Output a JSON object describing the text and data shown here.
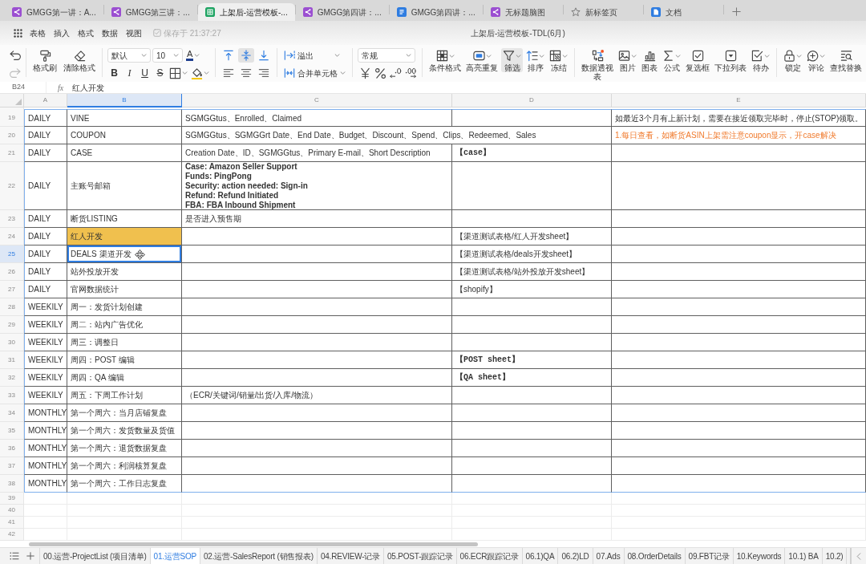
{
  "browser_tabs": [
    {
      "kind": "mindmap",
      "label": "GMGG第一讲：A...",
      "selected": false
    },
    {
      "kind": "mindmap",
      "label": "GMGG第三讲：...",
      "selected": false
    },
    {
      "kind": "sheet",
      "label": "上架后-运营模板-...",
      "selected": true
    },
    {
      "kind": "mindmap",
      "label": "GMGG第四讲：...",
      "selected": false
    },
    {
      "kind": "doc",
      "label": "GMGG第四讲：...",
      "selected": false
    },
    {
      "kind": "mindmap",
      "label": "无标题脑图",
      "selected": false
    },
    {
      "kind": "newtab",
      "label": "新标签页",
      "selected": false
    },
    {
      "kind": "home",
      "label": "文档",
      "selected": false
    }
  ],
  "menu": {
    "items": [
      "表格",
      "插入",
      "格式",
      "数据",
      "视图"
    ],
    "save_status": "保存于 21:37:27",
    "title": "上架后-运营模板-TDL(6月)"
  },
  "toolbar": {
    "undo": {
      "disabled": false
    },
    "redo": {
      "disabled": true
    },
    "format_painter": "格式刷",
    "clear_format": "清除格式",
    "font_dropdown": "默认",
    "size_dropdown": "10",
    "font_color": "A",
    "text_styles": [
      {
        "kind": "bold",
        "glyph": "B"
      },
      {
        "kind": "italic",
        "glyph": "I"
      },
      {
        "kind": "underline",
        "glyph": "U"
      },
      {
        "kind": "strike",
        "glyph": "S"
      }
    ],
    "vertical_align": [
      {
        "kind": "top",
        "selected": false
      },
      {
        "kind": "middle",
        "selected": true
      },
      {
        "kind": "bottom",
        "selected": false
      }
    ],
    "horizontal_align": [
      {
        "kind": "left",
        "selected": false
      },
      {
        "kind": "center",
        "selected": false
      },
      {
        "kind": "right",
        "selected": false
      }
    ],
    "wrap_dropdown": "溢出",
    "merge": "合并单元格",
    "number_dropdown": "常规",
    "tool_groups": [
      [
        {
          "kind": "conditional",
          "label": "条件格式",
          "dropdown": true,
          "active": false
        },
        {
          "kind": "highlight",
          "label": "高亮重复",
          "dropdown": true,
          "active": false
        },
        {
          "kind": "filter",
          "label": "筛选",
          "dropdown": true,
          "active": true
        },
        {
          "kind": "sort",
          "label": "排序",
          "dropdown": true,
          "active": false
        },
        {
          "kind": "freeze",
          "label": "冻结",
          "dropdown": true,
          "active": false
        }
      ],
      [
        {
          "kind": "pivot",
          "label": "数据透视表",
          "dropdown": false,
          "active": false
        },
        {
          "kind": "image",
          "label": "图片",
          "dropdown": true,
          "active": false
        },
        {
          "kind": "chart",
          "label": "图表",
          "dropdown": false,
          "active": false
        },
        {
          "kind": "formula",
          "label": "公式",
          "dropdown": true,
          "active": false
        },
        {
          "kind": "checkbox",
          "label": "复选框",
          "dropdown": false,
          "active": false
        },
        {
          "kind": "select",
          "label": "下拉列表",
          "dropdown": false,
          "active": false
        },
        {
          "kind": "todo",
          "label": "待办",
          "dropdown": true,
          "active": false
        }
      ],
      [
        {
          "kind": "lock",
          "label": "锁定",
          "dropdown": true,
          "active": false
        },
        {
          "kind": "comment",
          "label": "评论",
          "dropdown": true,
          "active": false
        },
        {
          "kind": "find",
          "label": "查找替换",
          "dropdown": false,
          "active": false
        }
      ]
    ]
  },
  "sheet": {
    "formula_bar": {
      "cell": "B24",
      "fx": "fx",
      "value": "红人开发"
    },
    "columns": [
      {
        "label": "A",
        "selected": false
      },
      {
        "label": "B",
        "selected": true
      },
      {
        "label": "C",
        "selected": false
      },
      {
        "label": "D",
        "selected": false
      },
      {
        "label": "E",
        "selected": false
      }
    ],
    "rows": [
      {
        "number": "19",
        "selected": false,
        "cells": [
          {
            "text": "DAILY",
            "selected": false
          },
          {
            "text": "VINE",
            "selected": false
          },
          {
            "text": "SGMGGtus、Enrolled、Claimed",
            "selected": false
          },
          {
            "selected": false
          },
          {
            "text": "如最近3个月有上新计划，需要在接近领取完毕时，停止(STOP)领取。",
            "selected": false
          }
        ]
      },
      {
        "number": "20",
        "selected": false,
        "cells": [
          {
            "text": "DAILY",
            "selected": false
          },
          {
            "text": "COUPON",
            "selected": false
          },
          {
            "text": "SGMGGtus、SGMGGrt Date、End Date、Budget、Discount、Spend、Clips、Redeemed、Sales",
            "selected": false
          },
          {
            "selected": false
          },
          {
            "text": "1.每日查看，如断货ASIN上架需注意coupon显示，开case解决",
            "color": "#f07b2e",
            "selected": false
          }
        ]
      },
      {
        "number": "21",
        "selected": false,
        "cells": [
          {
            "text": "DAILY",
            "selected": false
          },
          {
            "text": "CASE",
            "selected": false
          },
          {
            "text": "Creation Date、ID、SGMGGtus、Primary E-mail、Short Description",
            "selected": false
          },
          {
            "kind": "tag",
            "text": "【case】",
            "selected": false
          },
          {
            "selected": false
          }
        ]
      },
      {
        "number": "22",
        "selected": false,
        "cells": [
          {
            "text": "DAILY",
            "selected": false
          },
          {
            "text": "主账号邮箱",
            "selected": false
          },
          {
            "kind": "lines",
            "lines": [
              "Case: Amazon Seller Support",
              "Funds: PingPong",
              "Security: action needed: Sign-in",
              "Refund: Refund Initiated",
              "FBA: FBA Inbound Shipment"
            ],
            "selected": false
          },
          {
            "selected": false
          },
          {
            "selected": false
          }
        ]
      },
      {
        "number": "23",
        "selected": false,
        "cells": [
          {
            "text": "DAILY",
            "selected": false
          },
          {
            "text": "断货LISTING",
            "selected": false
          },
          {
            "text": "是否进入预售期",
            "selected": false
          },
          {
            "selected": false
          },
          {
            "selected": false
          }
        ]
      },
      {
        "number": "24",
        "selected": false,
        "cells": [
          {
            "text": "DAILY",
            "selected": false
          },
          {
            "kind": "highlight",
            "text": "红人开发",
            "color": "#f0c04e",
            "selected": false
          },
          {
            "selected": false
          },
          {
            "text": "【渠道测试表格/红人开发sheet】",
            "selected": false
          },
          {
            "selected": false
          }
        ]
      },
      {
        "number": "25",
        "selected": true,
        "cells": [
          {
            "text": "DAILY",
            "selected": false
          },
          {
            "text": "DEALS 渠道开发",
            "selected": true
          },
          {
            "selected": false
          },
          {
            "text": "【渠道测试表格/deals开发sheet】",
            "selected": false
          },
          {
            "selected": false
          }
        ]
      },
      {
        "number": "26",
        "selected": false,
        "cells": [
          {
            "text": "DAILY",
            "selected": false
          },
          {
            "text": "站外投放开发",
            "selected": false
          },
          {
            "selected": false
          },
          {
            "text": "【渠道测试表格/站外投放开发sheet】",
            "selected": false
          },
          {
            "selected": false
          }
        ]
      },
      {
        "number": "27",
        "selected": false,
        "cells": [
          {
            "text": "DAILY",
            "selected": false
          },
          {
            "text": "官网数据统计",
            "selected": false
          },
          {
            "selected": false
          },
          {
            "text": "【shopify】",
            "selected": false
          },
          {
            "selected": false
          }
        ]
      },
      {
        "number": "28",
        "selected": false,
        "cells": [
          {
            "text": "WEEKILY",
            "selected": false
          },
          {
            "text": "周一：发货计划创建",
            "selected": false
          },
          {
            "selected": false
          },
          {
            "selected": false
          },
          {
            "selected": false
          }
        ]
      },
      {
        "number": "29",
        "selected": false,
        "cells": [
          {
            "text": "WEEKILY",
            "selected": false
          },
          {
            "text": "周二：站内广告优化",
            "selected": false
          },
          {
            "selected": false
          },
          {
            "selected": false
          },
          {
            "selected": false
          }
        ]
      },
      {
        "number": "30",
        "selected": false,
        "cells": [
          {
            "text": "WEEKILY",
            "selected": false
          },
          {
            "text": "周三：调整日",
            "selected": false
          },
          {
            "selected": false
          },
          {
            "selected": false
          },
          {
            "selected": false
          }
        ]
      },
      {
        "number": "31",
        "selected": false,
        "cells": [
          {
            "text": "WEEKILY",
            "selected": false
          },
          {
            "text": "周四：POST 编辑",
            "selected": false
          },
          {
            "selected": false
          },
          {
            "kind": "tag",
            "text": "【POST sheet】",
            "selected": false
          },
          {
            "selected": false
          }
        ]
      },
      {
        "number": "32",
        "selected": false,
        "cells": [
          {
            "text": "WEEKILY",
            "selected": false
          },
          {
            "text": "周四：QA 编辑",
            "selected": false
          },
          {
            "selected": false
          },
          {
            "kind": "tag",
            "text": "【QA sheet】",
            "selected": false
          },
          {
            "selected": false
          }
        ]
      },
      {
        "number": "33",
        "selected": false,
        "cells": [
          {
            "text": "WEEKILY",
            "selected": false
          },
          {
            "text": "周五：下周工作计划",
            "selected": false
          },
          {
            "text": "（ECR/关键词/销量/出货/入库/物流）",
            "selected": false
          },
          {
            "selected": false
          },
          {
            "selected": false
          }
        ]
      },
      {
        "number": "34",
        "selected": false,
        "cells": [
          {
            "text": "MONTHLY",
            "selected": false
          },
          {
            "text": "第一个周六：当月店铺复盘",
            "selected": false
          },
          {
            "selected": false
          },
          {
            "selected": false
          },
          {
            "selected": false
          }
        ]
      },
      {
        "number": "35",
        "selected": false,
        "cells": [
          {
            "text": "MONTHLY",
            "selected": false
          },
          {
            "text": "第一个周六：发货数量及货值",
            "selected": false
          },
          {
            "selected": false
          },
          {
            "selected": false
          },
          {
            "selected": false
          }
        ]
      },
      {
        "number": "36",
        "selected": false,
        "cells": [
          {
            "text": "MONTHLY",
            "selected": false
          },
          {
            "text": "第一个周六：退货数据复盘",
            "selected": false
          },
          {
            "selected": false
          },
          {
            "selected": false
          },
          {
            "selected": false
          }
        ]
      },
      {
        "number": "37",
        "selected": false,
        "cells": [
          {
            "text": "MONTHLY",
            "selected": false
          },
          {
            "text": "第一个周六：利润核算复盘",
            "selected": false
          },
          {
            "selected": false
          },
          {
            "selected": false
          },
          {
            "selected": false
          }
        ]
      },
      {
        "number": "38",
        "selected": false,
        "cells": [
          {
            "text": "MONTHLY",
            "selected": false
          },
          {
            "text": "第一个周六：工作日志复盘",
            "selected": false
          },
          {
            "selected": false
          },
          {
            "selected": false
          },
          {
            "selected": false
          }
        ]
      },
      {
        "number": "39",
        "selected": false
      },
      {
        "number": "40",
        "selected": false
      },
      {
        "number": "41",
        "selected": false
      },
      {
        "number": "42",
        "selected": false
      }
    ]
  },
  "sheet_tabs": [
    {
      "label": "00.运营-ProjectList (项目清单)",
      "selected": false
    },
    {
      "label": "01.运营SOP",
      "selected": true
    },
    {
      "label": "02.运营-SalesReport (销售报表)",
      "selected": false
    },
    {
      "label": "04.REVIEW-记录",
      "selected": false
    },
    {
      "label": "05.POST-跟踪记录",
      "selected": false
    },
    {
      "label": "06.ECR跟踪记录",
      "selected": false
    },
    {
      "label": "06.1)QA",
      "selected": false
    },
    {
      "label": "06.2)LD",
      "selected": false
    },
    {
      "label": "07.Ads",
      "selected": false
    },
    {
      "label": "08.OrderDetails",
      "selected": false
    },
    {
      "label": "09.FBT记录",
      "selected": false
    },
    {
      "label": "10.Keywords",
      "selected": false
    },
    {
      "label": "10.1) BA",
      "selected": false
    },
    {
      "label": "10.2)",
      "selected": false
    }
  ]
}
